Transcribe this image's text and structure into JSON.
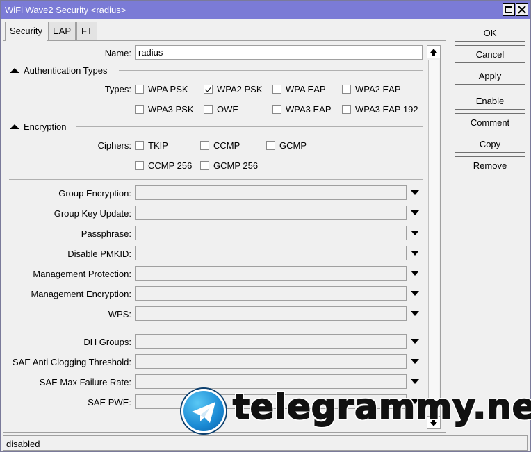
{
  "window": {
    "title": "WiFi Wave2 Security <radius>"
  },
  "tabs": [
    {
      "label": "Security",
      "active": true
    },
    {
      "label": "EAP",
      "active": false
    },
    {
      "label": "FT",
      "active": false
    }
  ],
  "form": {
    "name_label": "Name:",
    "name_value": "radius",
    "auth_section": "Authentication Types",
    "types_label": "Types:",
    "types": [
      {
        "label": "WPA PSK",
        "checked": false
      },
      {
        "label": "WPA2 PSK",
        "checked": true
      },
      {
        "label": "WPA EAP",
        "checked": false
      },
      {
        "label": "WPA2 EAP",
        "checked": false
      },
      {
        "label": "WPA3 PSK",
        "checked": false
      },
      {
        "label": "OWE",
        "checked": false
      },
      {
        "label": "WPA3 EAP",
        "checked": false
      },
      {
        "label": "WPA3 EAP 192",
        "checked": false
      }
    ],
    "enc_section": "Encryption",
    "ciphers_label": "Ciphers:",
    "ciphers": [
      {
        "label": "TKIP",
        "checked": false
      },
      {
        "label": "CCMP",
        "checked": false
      },
      {
        "label": "GCMP",
        "checked": false
      },
      {
        "label": "CCMP 256",
        "checked": false
      },
      {
        "label": "GCMP 256",
        "checked": false
      }
    ],
    "dropdowns": [
      {
        "label": "Group Encryption:",
        "value": ""
      },
      {
        "label": "Group Key Update:",
        "value": ""
      },
      {
        "label": "Passphrase:",
        "value": ""
      },
      {
        "label": "Disable PMKID:",
        "value": ""
      },
      {
        "label": "Management Protection:",
        "value": ""
      },
      {
        "label": "Management Encryption:",
        "value": ""
      },
      {
        "label": "WPS:",
        "value": ""
      },
      {
        "label": "DH Groups:",
        "value": ""
      },
      {
        "label": "SAE Anti Clogging Threshold:",
        "value": ""
      },
      {
        "label": "SAE Max Failure Rate:",
        "value": ""
      },
      {
        "label": "SAE PWE:",
        "value": ""
      }
    ]
  },
  "buttons": {
    "ok": "OK",
    "cancel": "Cancel",
    "apply": "Apply",
    "enable": "Enable",
    "comment": "Comment",
    "copy": "Copy",
    "remove": "Remove"
  },
  "status": {
    "text": "disabled"
  },
  "watermark": {
    "text": "telegrammy.net"
  },
  "colors": {
    "titlebar": "#7b7bd6",
    "background": "#f0f0f0"
  }
}
